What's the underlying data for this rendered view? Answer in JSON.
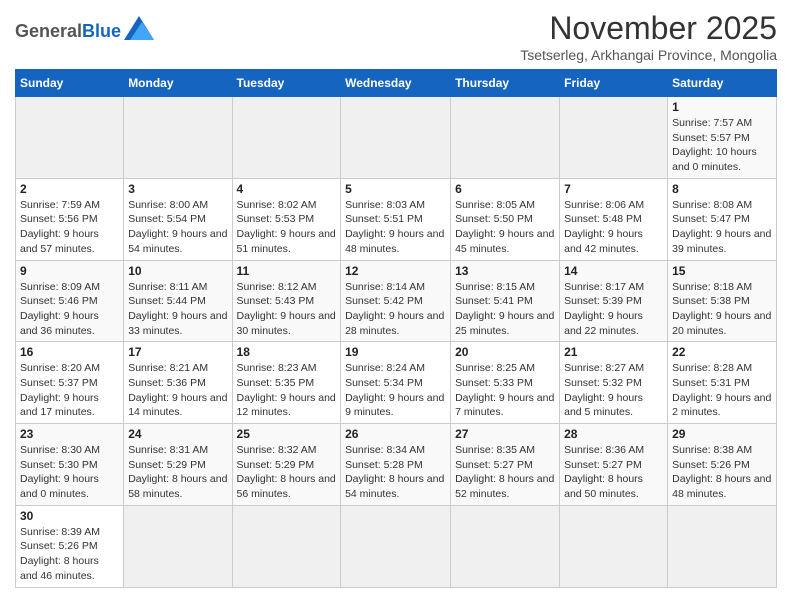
{
  "header": {
    "logo_general": "General",
    "logo_blue": "Blue",
    "month_title": "November 2025",
    "subtitle": "Tsetserleg, Arkhangai Province, Mongolia"
  },
  "days_of_week": [
    "Sunday",
    "Monday",
    "Tuesday",
    "Wednesday",
    "Thursday",
    "Friday",
    "Saturday"
  ],
  "weeks": [
    [
      {
        "day": "",
        "info": ""
      },
      {
        "day": "",
        "info": ""
      },
      {
        "day": "",
        "info": ""
      },
      {
        "day": "",
        "info": ""
      },
      {
        "day": "",
        "info": ""
      },
      {
        "day": "",
        "info": ""
      },
      {
        "day": "1",
        "info": "Sunrise: 7:57 AM\nSunset: 5:57 PM\nDaylight: 10 hours and 0 minutes."
      }
    ],
    [
      {
        "day": "2",
        "info": "Sunrise: 7:59 AM\nSunset: 5:56 PM\nDaylight: 9 hours and 57 minutes."
      },
      {
        "day": "3",
        "info": "Sunrise: 8:00 AM\nSunset: 5:54 PM\nDaylight: 9 hours and 54 minutes."
      },
      {
        "day": "4",
        "info": "Sunrise: 8:02 AM\nSunset: 5:53 PM\nDaylight: 9 hours and 51 minutes."
      },
      {
        "day": "5",
        "info": "Sunrise: 8:03 AM\nSunset: 5:51 PM\nDaylight: 9 hours and 48 minutes."
      },
      {
        "day": "6",
        "info": "Sunrise: 8:05 AM\nSunset: 5:50 PM\nDaylight: 9 hours and 45 minutes."
      },
      {
        "day": "7",
        "info": "Sunrise: 8:06 AM\nSunset: 5:48 PM\nDaylight: 9 hours and 42 minutes."
      },
      {
        "day": "8",
        "info": "Sunrise: 8:08 AM\nSunset: 5:47 PM\nDaylight: 9 hours and 39 minutes."
      }
    ],
    [
      {
        "day": "9",
        "info": "Sunrise: 8:09 AM\nSunset: 5:46 PM\nDaylight: 9 hours and 36 minutes."
      },
      {
        "day": "10",
        "info": "Sunrise: 8:11 AM\nSunset: 5:44 PM\nDaylight: 9 hours and 33 minutes."
      },
      {
        "day": "11",
        "info": "Sunrise: 8:12 AM\nSunset: 5:43 PM\nDaylight: 9 hours and 30 minutes."
      },
      {
        "day": "12",
        "info": "Sunrise: 8:14 AM\nSunset: 5:42 PM\nDaylight: 9 hours and 28 minutes."
      },
      {
        "day": "13",
        "info": "Sunrise: 8:15 AM\nSunset: 5:41 PM\nDaylight: 9 hours and 25 minutes."
      },
      {
        "day": "14",
        "info": "Sunrise: 8:17 AM\nSunset: 5:39 PM\nDaylight: 9 hours and 22 minutes."
      },
      {
        "day": "15",
        "info": "Sunrise: 8:18 AM\nSunset: 5:38 PM\nDaylight: 9 hours and 20 minutes."
      }
    ],
    [
      {
        "day": "16",
        "info": "Sunrise: 8:20 AM\nSunset: 5:37 PM\nDaylight: 9 hours and 17 minutes."
      },
      {
        "day": "17",
        "info": "Sunrise: 8:21 AM\nSunset: 5:36 PM\nDaylight: 9 hours and 14 minutes."
      },
      {
        "day": "18",
        "info": "Sunrise: 8:23 AM\nSunset: 5:35 PM\nDaylight: 9 hours and 12 minutes."
      },
      {
        "day": "19",
        "info": "Sunrise: 8:24 AM\nSunset: 5:34 PM\nDaylight: 9 hours and 9 minutes."
      },
      {
        "day": "20",
        "info": "Sunrise: 8:25 AM\nSunset: 5:33 PM\nDaylight: 9 hours and 7 minutes."
      },
      {
        "day": "21",
        "info": "Sunrise: 8:27 AM\nSunset: 5:32 PM\nDaylight: 9 hours and 5 minutes."
      },
      {
        "day": "22",
        "info": "Sunrise: 8:28 AM\nSunset: 5:31 PM\nDaylight: 9 hours and 2 minutes."
      }
    ],
    [
      {
        "day": "23",
        "info": "Sunrise: 8:30 AM\nSunset: 5:30 PM\nDaylight: 9 hours and 0 minutes."
      },
      {
        "day": "24",
        "info": "Sunrise: 8:31 AM\nSunset: 5:29 PM\nDaylight: 8 hours and 58 minutes."
      },
      {
        "day": "25",
        "info": "Sunrise: 8:32 AM\nSunset: 5:29 PM\nDaylight: 8 hours and 56 minutes."
      },
      {
        "day": "26",
        "info": "Sunrise: 8:34 AM\nSunset: 5:28 PM\nDaylight: 8 hours and 54 minutes."
      },
      {
        "day": "27",
        "info": "Sunrise: 8:35 AM\nSunset: 5:27 PM\nDaylight: 8 hours and 52 minutes."
      },
      {
        "day": "28",
        "info": "Sunrise: 8:36 AM\nSunset: 5:27 PM\nDaylight: 8 hours and 50 minutes."
      },
      {
        "day": "29",
        "info": "Sunrise: 8:38 AM\nSunset: 5:26 PM\nDaylight: 8 hours and 48 minutes."
      }
    ],
    [
      {
        "day": "30",
        "info": "Sunrise: 8:39 AM\nSunset: 5:26 PM\nDaylight: 8 hours and 46 minutes."
      },
      {
        "day": "",
        "info": ""
      },
      {
        "day": "",
        "info": ""
      },
      {
        "day": "",
        "info": ""
      },
      {
        "day": "",
        "info": ""
      },
      {
        "day": "",
        "info": ""
      },
      {
        "day": "",
        "info": ""
      }
    ]
  ]
}
